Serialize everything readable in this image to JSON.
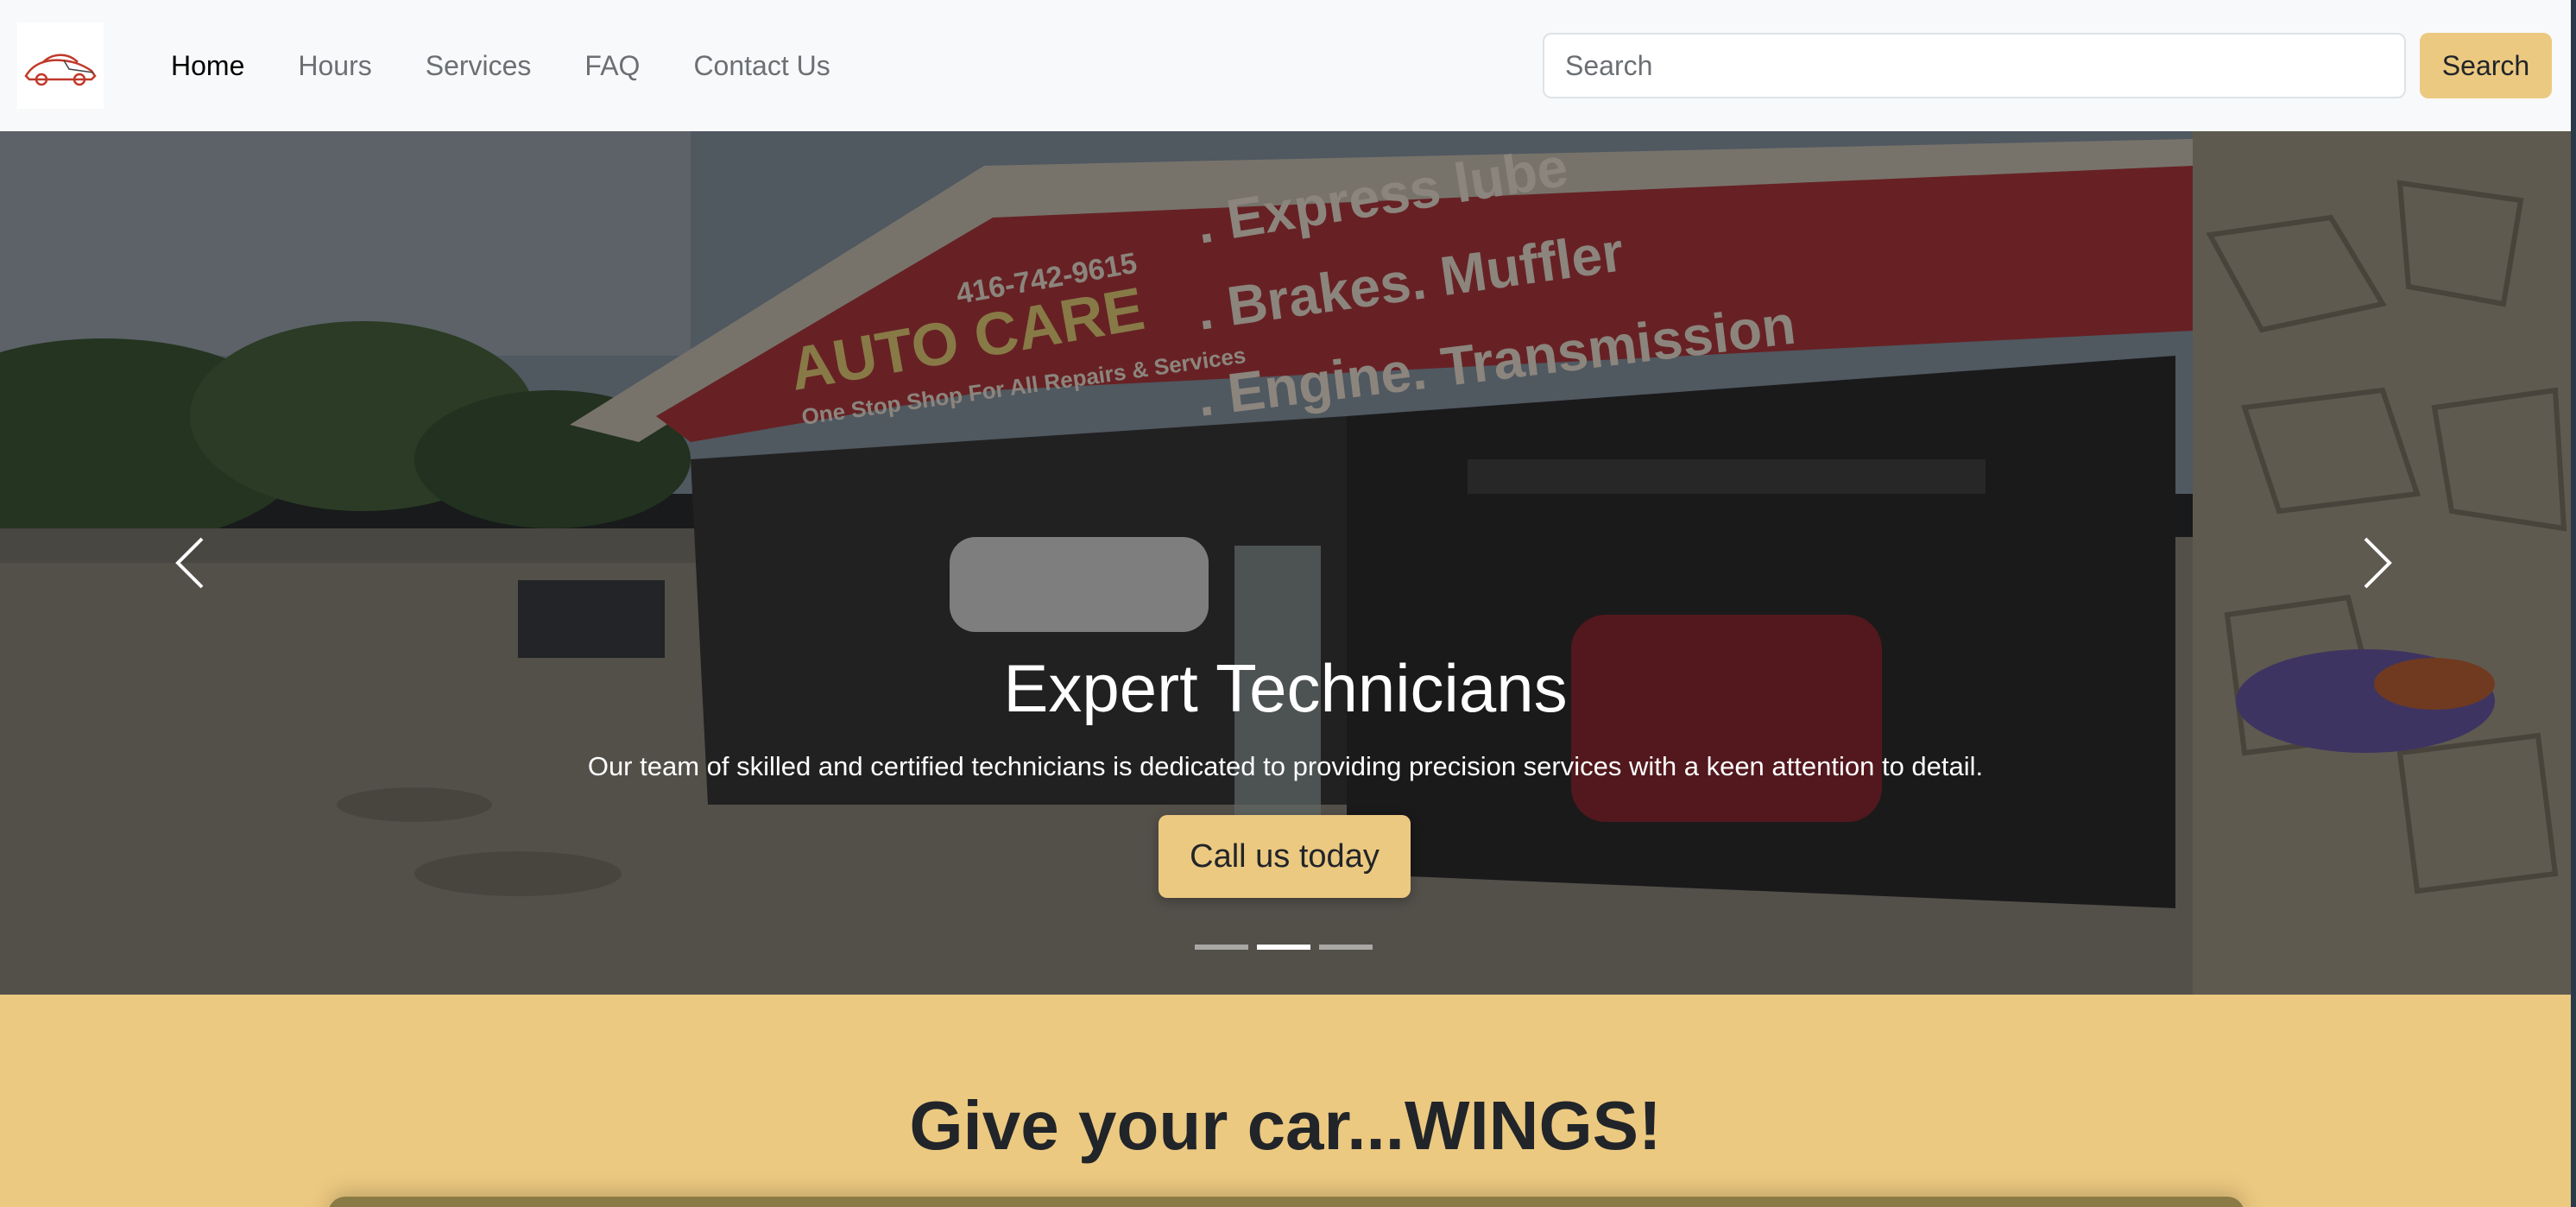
{
  "navbar": {
    "logo_icon": "car-logo-icon",
    "links": [
      {
        "label": "Home",
        "active": true
      },
      {
        "label": "Hours",
        "active": false
      },
      {
        "label": "Services",
        "active": false
      },
      {
        "label": "FAQ",
        "active": false
      },
      {
        "label": "Contact Us",
        "active": false
      }
    ],
    "search": {
      "placeholder": "Search",
      "button_label": "Search"
    }
  },
  "hero": {
    "signage": {
      "phone": "416-742-9615",
      "name": "AUTO CARE",
      "tagline": "One Stop Shop For All Repairs & Services",
      "services": [
        ". Express lube",
        ". Brakes. Muffler",
        ". Engine. Transmission"
      ]
    },
    "title": "Expert Technicians",
    "text": "Our team of skilled and certified technicians is dedicated to providing precision services with a keen attention to detail.",
    "cta_label": "Call us today",
    "prev_icon": "chevron-left-icon",
    "next_icon": "chevron-right-icon",
    "slides_count": 3,
    "active_slide": 2
  },
  "banner": {
    "title": "Give your car...WINGS!"
  },
  "colors": {
    "accent": "#ecc981",
    "navbar_bg": "#f8f9fa",
    "nav_text": "#6c6f73"
  }
}
